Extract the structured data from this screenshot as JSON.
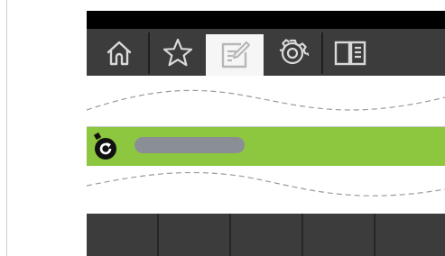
{
  "toolbar": {
    "tabs": [
      {
        "name": "home",
        "icon": "home-icon",
        "active": false
      },
      {
        "name": "favorites",
        "icon": "star-icon",
        "active": false
      },
      {
        "name": "edit",
        "icon": "edit-note-icon",
        "active": true
      },
      {
        "name": "settings",
        "icon": "gear-icon",
        "active": false
      },
      {
        "name": "reader",
        "icon": "book-icon",
        "active": false
      }
    ]
  },
  "status_row": {
    "icon": "refresh-badge-icon",
    "bar_color": "#8dc63f",
    "track_color": "#8a8f96"
  },
  "bottom_grid": {
    "cells": 5
  },
  "colors": {
    "toolbar_bg": "#3c3c3c",
    "active_tab_bg": "#f6f6f6",
    "top_bar": "#000000",
    "accent": "#8dc63f"
  }
}
